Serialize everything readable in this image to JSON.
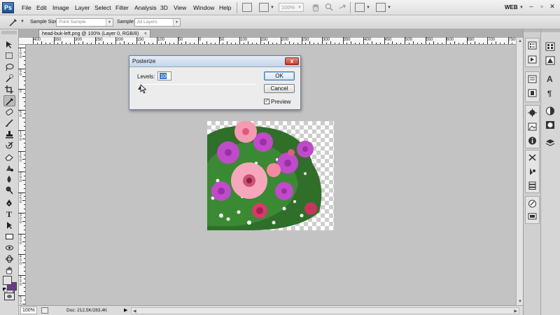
{
  "app": {
    "logo": "Ps"
  },
  "menubar": {
    "items": [
      "File",
      "Edit",
      "Image",
      "Layer",
      "Select",
      "Filter",
      "Analysis",
      "3D",
      "View",
      "Window",
      "Help"
    ],
    "zoom": "100%",
    "workspace": "WEB",
    "window_controls": {
      "minimize": "–",
      "restore": "▫",
      "close": "✕"
    }
  },
  "options": {
    "sample_size_label": "Sample Size:",
    "sample_size_value": "Point Sample",
    "sample_label": "Sample:",
    "sample_value": "All Layers"
  },
  "document": {
    "tab_title": "head-buk-left.png @ 100% (Layer 0, RGB/8)",
    "tab_close": "×"
  },
  "rulers": {
    "top_labels": [
      "400",
      "350",
      "300",
      "250",
      "200",
      "150",
      "100",
      "50",
      "0",
      "50",
      "100",
      "150",
      "200",
      "250",
      "300",
      "350",
      "400",
      "450",
      "500",
      "550",
      "600",
      "650",
      "700",
      "750",
      "800"
    ],
    "left_labels": [
      "100",
      "50",
      "0",
      "50",
      "100",
      "150",
      "200",
      "250",
      "300",
      "350",
      "400",
      "450",
      "500"
    ]
  },
  "status": {
    "zoom": "100%",
    "doc_info": "Doc: 212,5K/283,4K",
    "arrow": "▶"
  },
  "dialog": {
    "title": "Posterize",
    "close_label": "x",
    "levels_label": "Levels:",
    "levels_value": "10",
    "ok_label": "OK",
    "cancel_label": "Cancel",
    "preview_label": "Preview",
    "preview_checked": "✓"
  },
  "colors": {
    "foreground": "#e4e4e4",
    "background": "#6a3b8c",
    "dialog_title_gradient": "#c5d6ea",
    "close_button": "#c23b2a"
  },
  "tools": [
    "move-tool-icon",
    "marquee-tool-icon",
    "lasso-tool-icon",
    "quick-selection-tool-icon",
    "crop-tool-icon",
    "eyedropper-tool-icon",
    "spot-healing-tool-icon",
    "brush-tool-icon",
    "clone-stamp-tool-icon",
    "history-brush-tool-icon",
    "eraser-tool-icon",
    "gradient-tool-icon",
    "blur-tool-icon",
    "dodge-tool-icon",
    "pen-tool-icon",
    "type-tool-icon",
    "path-selection-tool-icon",
    "shape-tool-icon",
    "3d-rotate-tool-icon",
    "3d-orbit-tool-icon",
    "hand-tool-icon",
    "zoom-tool-icon"
  ]
}
